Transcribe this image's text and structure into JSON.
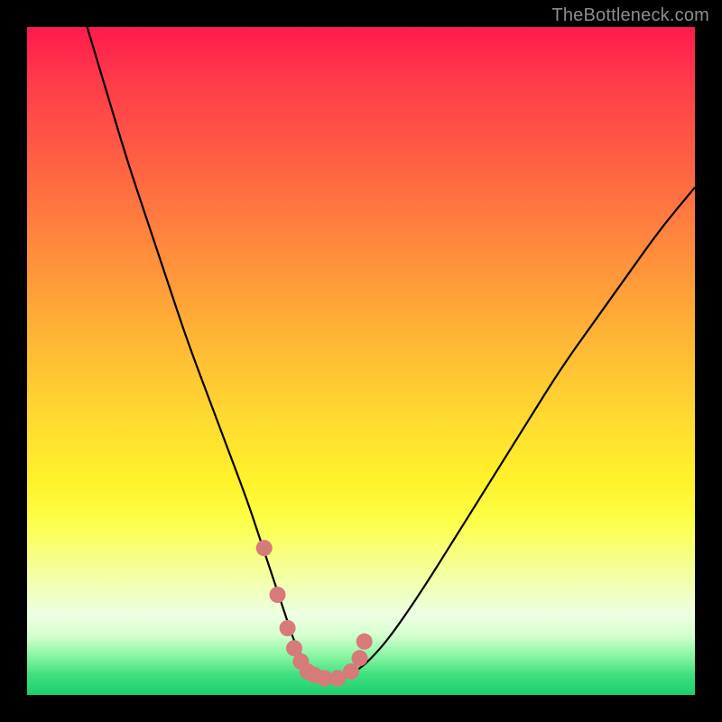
{
  "watermark": "TheBottleneck.com",
  "chart_data": {
    "type": "line",
    "title": "",
    "xlabel": "",
    "ylabel": "",
    "xlim": [
      0,
      100
    ],
    "ylim": [
      0,
      100
    ],
    "grid": false,
    "legend": false,
    "series": [
      {
        "name": "bottleneck-curve",
        "color": "#000000",
        "x": [
          9,
          12,
          15,
          18,
          21,
          24,
          27,
          30,
          33,
          35,
          36,
          37,
          38,
          39,
          40,
          41,
          42,
          43,
          44,
          45,
          46,
          47,
          48,
          50,
          53,
          56,
          60,
          65,
          70,
          75,
          80,
          85,
          90,
          95,
          100
        ],
        "y": [
          100,
          90,
          80,
          71,
          62,
          53,
          45,
          37,
          29,
          23,
          20,
          17,
          14,
          11,
          8,
          6,
          4,
          3,
          2,
          2,
          2,
          2,
          3,
          4,
          7,
          11,
          17,
          25,
          33,
          41,
          49,
          56,
          63,
          70,
          76
        ]
      },
      {
        "name": "highlight-dots",
        "color": "#d77a7a",
        "type": "scatter",
        "x": [
          35.5,
          37.5,
          39.0,
          40.0,
          41.0,
          42.0,
          43.0,
          44.5,
          46.5,
          48.5,
          49.8,
          50.5
        ],
        "y": [
          22.0,
          15.0,
          10.0,
          7.0,
          5.0,
          3.5,
          3.0,
          2.5,
          2.5,
          3.5,
          5.5,
          8.0
        ]
      }
    ],
    "colors": {
      "gradient_top": "#ff1a4d",
      "gradient_mid": "#fff22b",
      "gradient_bottom": "#1ecf6e",
      "frame": "#000000",
      "watermark": "#8d8d8d"
    }
  }
}
